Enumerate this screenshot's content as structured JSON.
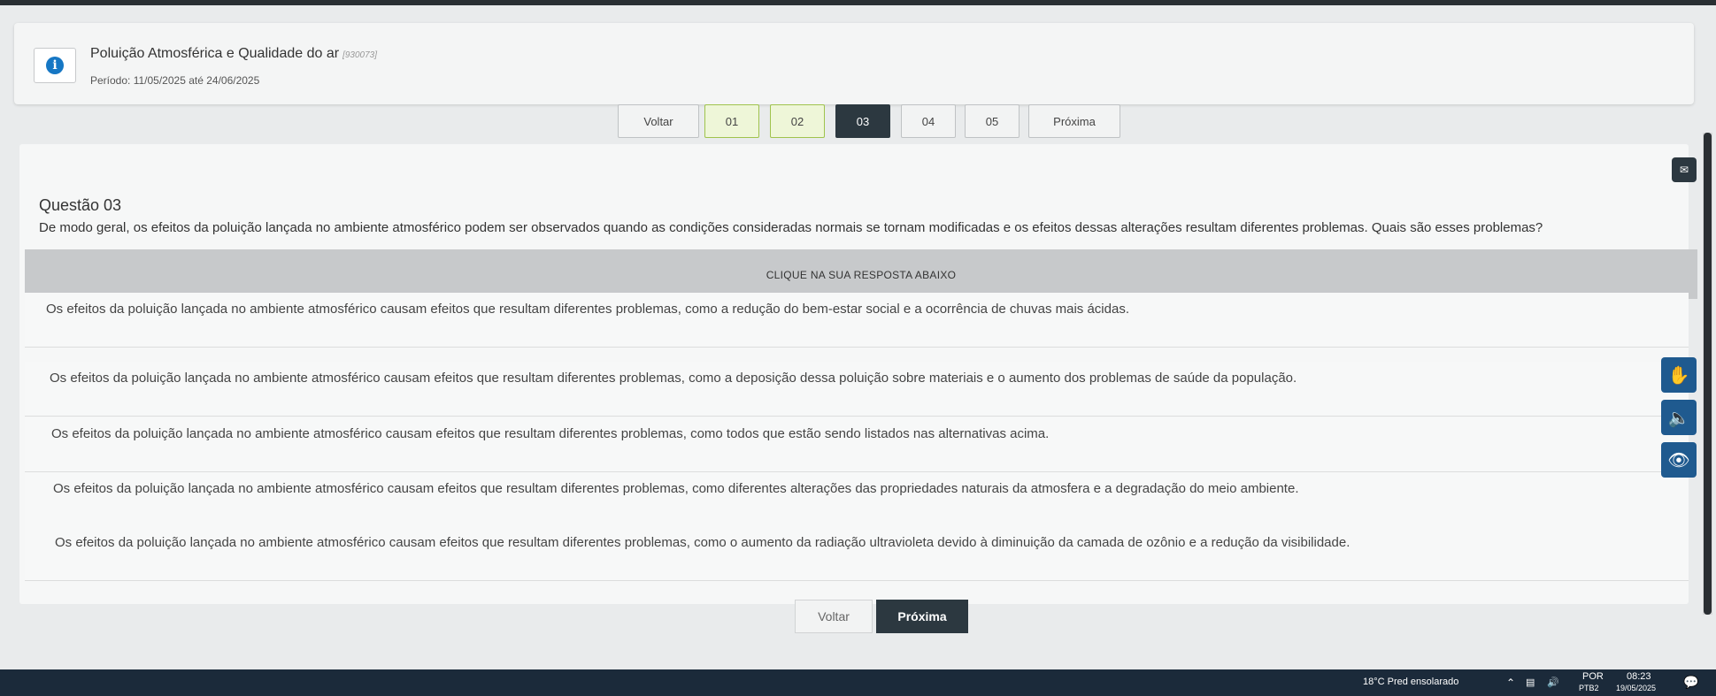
{
  "header": {
    "title": "Poluição Atmosférica e Qualidade do ar",
    "code": "[930073]",
    "period": "Período: 11/05/2025 até 24/06/2025",
    "icon": "info-icon"
  },
  "pager": {
    "back_label": "Voltar",
    "next_label": "Próxima",
    "pages": [
      {
        "label": "01",
        "state": "answered"
      },
      {
        "label": "02",
        "state": "answered"
      },
      {
        "label": "03",
        "state": "current"
      },
      {
        "label": "04",
        "state": "pending"
      },
      {
        "label": "05",
        "state": "pending"
      }
    ]
  },
  "question": {
    "title": "Questão 03",
    "text": "De modo geral, os efeitos da poluição lançada no ambiente atmosférico podem ser observados quando as condições consideradas normais se tornam modificadas e os efeitos dessas alterações resultam diferentes problemas. Quais são esses problemas?",
    "hint": "CLIQUE NA SUA RESPOSTA ABAIXO",
    "answers": [
      "Os efeitos da poluição lançada no ambiente atmosférico causam efeitos que resultam diferentes problemas, como a redução do bem-estar social e a ocorrência de chuvas mais ácidas.",
      "Os efeitos da poluição lançada no ambiente atmosférico causam efeitos que resultam diferentes problemas, como a deposição dessa poluição sobre materiais e o aumento dos problemas de saúde da população.",
      "Os efeitos da poluição lançada no ambiente atmosférico causam efeitos que resultam diferentes problemas, como todos que estão sendo listados nas alternativas acima.",
      "Os efeitos da poluição lançada no ambiente atmosférico causam efeitos que resultam diferentes problemas, como diferentes alterações das propriedades naturais da atmosfera e a degradação do meio ambiente.",
      "Os efeitos da poluição lançada no ambiente atmosférico causam efeitos que resultam diferentes problemas, como o aumento da radiação ultravioleta devido à diminuição da camada de ozônio e a redução da visibilidade."
    ]
  },
  "bottom_nav": {
    "back_label": "Voltar",
    "next_label": "Próxima"
  },
  "accessibility": {
    "icons": [
      "mail-icon",
      "sign-language-icon",
      "audio-speaker-icon",
      "eye-icon"
    ]
  },
  "taskbar": {
    "weather": "18°C  Pred ensolarado",
    "language": "POR",
    "language_sub": "PTB2",
    "time": "08:23",
    "date": "19/05/2025"
  },
  "colors": {
    "current_page": "#2c3840",
    "answered_page": "#eef6d8",
    "accent_blue": "#1677c4",
    "taskbar": "#1b2a3a"
  }
}
